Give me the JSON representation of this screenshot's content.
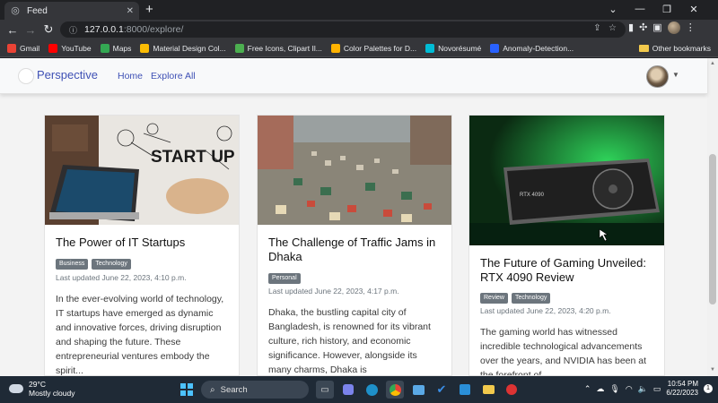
{
  "browser": {
    "tab_title": "Feed",
    "url_host": "127.0.0.1",
    "url_rest": ":8000/explore/",
    "bookmarks": [
      {
        "label": "Gmail",
        "color": "#ea4335"
      },
      {
        "label": "YouTube",
        "color": "#ff0000"
      },
      {
        "label": "Maps",
        "color": "#34a853"
      },
      {
        "label": "Material Design Col...",
        "color": "#fbbc04"
      },
      {
        "label": "Free Icons, Clipart Il...",
        "color": "#4caf50"
      },
      {
        "label": "Color Palettes for D...",
        "color": "#ffb300"
      },
      {
        "label": "Novorésumé",
        "color": "#00bcd4"
      },
      {
        "label": "Anomaly-Detection...",
        "color": "#2962ff"
      }
    ],
    "other_bookmarks": "Other bookmarks"
  },
  "site": {
    "brand": "Perspective",
    "nav": [
      "Home",
      "Explore All"
    ]
  },
  "cards": [
    {
      "title": "The Power of IT Startups",
      "tags": [
        "Business",
        "Technology"
      ],
      "updated": "Last updated June 22, 2023, 4:10 p.m.",
      "excerpt": "In the ever-evolving world of technology, IT startups have emerged as dynamic and innovative forces, driving disruption and shaping the future. These entrepreneurial ventures embody the spirit...",
      "image_text": "START UP"
    },
    {
      "title": "The Challenge of Traffic Jams in Dhaka",
      "tags": [
        "Personal"
      ],
      "updated": "Last updated June 22, 2023, 4:17 p.m.",
      "excerpt": "Dhaka, the bustling capital city of Bangladesh, is renowned for its vibrant culture, rich history, and economic significance. However, alongside its many charms, Dhaka is"
    },
    {
      "title": "The Future of Gaming Unveiled: RTX 4090 Review",
      "tags": [
        "Review",
        "Technology"
      ],
      "updated": "Last updated June 22, 2023, 4:20 p.m.",
      "excerpt": "The gaming world has witnessed incredible technological advancements over the years, and NVIDIA has been at the forefront of",
      "image_text": "RTX 4090"
    }
  ],
  "taskbar": {
    "temperature": "29°C",
    "weather": "Mostly cloudy",
    "search_label": "Search",
    "time": "10:54 PM",
    "date": "6/22/2023"
  },
  "colors": {
    "brand": "#3f51b5",
    "badge": "#6c757d",
    "button": "#0d6efd"
  }
}
